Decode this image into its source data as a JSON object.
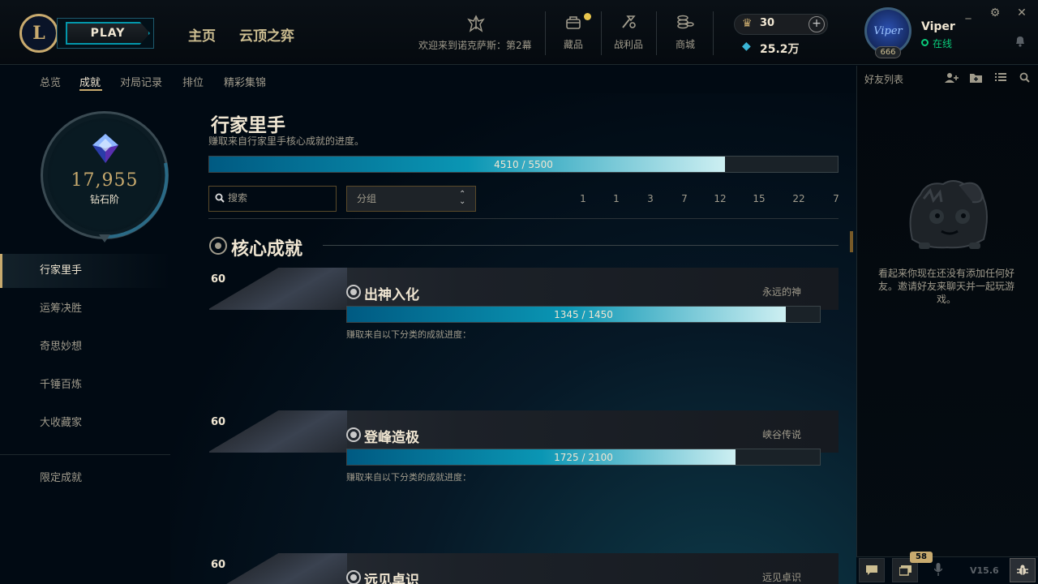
{
  "header": {
    "logo_letter": "L",
    "play_label": "PLAY",
    "nav": [
      "主页",
      "云顶之弈"
    ],
    "welcome_text": "欢迎来到诺克萨斯：第2幕",
    "icons": [
      {
        "label": "藏品",
        "icon": "collection-bag-icon"
      },
      {
        "label": "战利品",
        "icon": "loot-icon"
      },
      {
        "label": "商城",
        "icon": "store-coins-icon"
      }
    ],
    "currency_rp": "30",
    "currency_be": "25.2万",
    "user": {
      "name": "Viper",
      "status": "在线",
      "level": "666",
      "avatar_text": "Viper"
    }
  },
  "subnav": {
    "tabs": [
      "总览",
      "成就",
      "对局记录",
      "排位",
      "精彩集锦"
    ],
    "active": "成就"
  },
  "sidebar": {
    "score": "17,955",
    "tier": "钻石阶",
    "items": [
      "行家里手",
      "运筹决胜",
      "奇思妙想",
      "千锤百炼",
      "大收藏家"
    ],
    "special": "限定成就",
    "active": "行家里手"
  },
  "main": {
    "title": "行家里手",
    "subtitle": "赚取来自行家里手核心成就的进度。",
    "progress": {
      "current": 4510,
      "max": 5500,
      "text": "4510 / 5500"
    },
    "search_placeholder": "搜索",
    "group_label": "分组",
    "counts": [
      "1",
      "1",
      "3",
      "7",
      "12",
      "15",
      "22",
      "7"
    ],
    "section_title": "核心成就",
    "cards": [
      {
        "points": "60",
        "name": "出神入化",
        "reward": "永远的神",
        "current": 1345,
        "max": 1450,
        "text": "1345 / 1450",
        "desc": "赚取来自以下分类的成就进度："
      },
      {
        "points": "60",
        "name": "登峰造极",
        "reward": "峡谷传说",
        "current": 1725,
        "max": 2100,
        "text": "1725 / 2100",
        "desc": "赚取来自以下分类的成就进度："
      },
      {
        "points": "60",
        "name": "远见卓识",
        "reward": "远见卓识"
      }
    ]
  },
  "friends": {
    "title": "好友列表",
    "empty_message": "看起来你现在还没有添加任何好友。邀请好友来聊天并一起玩游戏。",
    "badge": "58",
    "version": "V15.6"
  },
  "colors": {
    "gold": "#c8aa6e",
    "teal": "#0397ab",
    "online": "#0acb7a",
    "bg": "#010a13"
  }
}
